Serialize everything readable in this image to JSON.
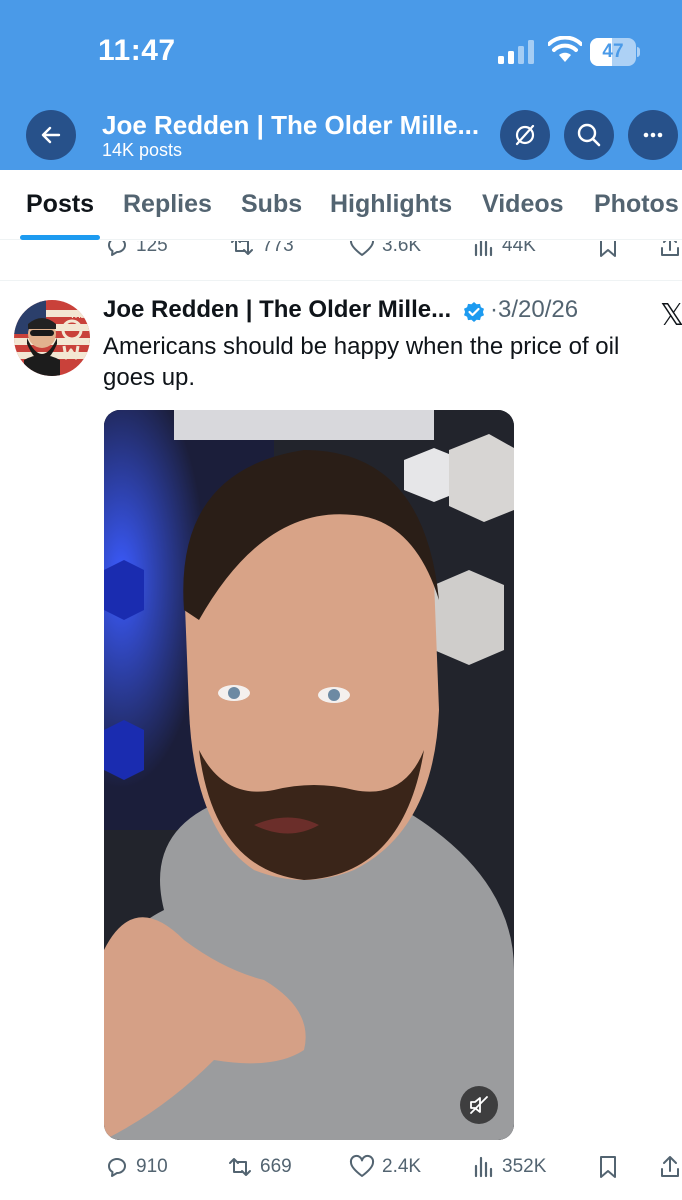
{
  "status_bar": {
    "time": "11:47",
    "battery": "47",
    "battery_level": 0.47
  },
  "nav": {
    "title": "Joe Redden | The Older Mille...",
    "subtitle": "14K posts",
    "icons": [
      "back-arrow-icon",
      "unsubscribe-icon",
      "search-icon",
      "more-icon"
    ]
  },
  "tabs": [
    {
      "label": "Posts",
      "active": true
    },
    {
      "label": "Replies",
      "active": false
    },
    {
      "label": "Subs",
      "active": false
    },
    {
      "label": "Highlights",
      "active": false
    },
    {
      "label": "Videos",
      "active": false
    },
    {
      "label": "Photos",
      "active": false
    }
  ],
  "previous_post": {
    "replies": "125",
    "reposts": "773",
    "likes": "3.6K",
    "views": "44K"
  },
  "post": {
    "author": "Joe Redden | The Older Mille...",
    "separator": "·",
    "date": "3/20/26",
    "text": "Americans should be happy when the price of oil goes up.",
    "replies": "910",
    "reposts": "669",
    "likes": "2.4K",
    "views": "352K",
    "avatar_letters": "THE OM"
  },
  "x_logo": "𝕏",
  "colors": {
    "header_bg": "#4a9ae8",
    "nav_button_bg": "#27518a",
    "accent": "#1d9bf0",
    "text_primary": "#0f1419",
    "text_secondary": "#536471"
  }
}
